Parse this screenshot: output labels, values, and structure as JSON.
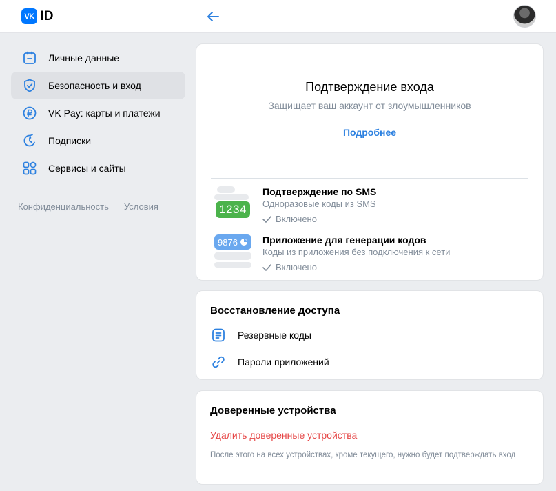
{
  "header": {
    "logo_badge": "VK",
    "logo_text": "ID"
  },
  "sidebar": {
    "items": [
      {
        "label": "Личные данные",
        "icon": "profile-card-icon",
        "active": false
      },
      {
        "label": "Безопасность и вход",
        "icon": "shield-check-icon",
        "active": true
      },
      {
        "label": "VK Pay: карты и платежи",
        "icon": "ruble-circle-icon",
        "active": false
      },
      {
        "label": "Подписки",
        "icon": "subscription-refresh-icon",
        "active": false
      },
      {
        "label": "Сервисы и сайты",
        "icon": "grid-services-icon",
        "active": false
      }
    ],
    "footer_links": [
      "Конфиденциальность",
      "Условия"
    ]
  },
  "login_confirmation": {
    "title": "Подтверждение входа",
    "subtitle": "Защищает ваш аккаунт от злоумышленников",
    "more_link": "Подробнее",
    "methods": [
      {
        "title": "Подтверждение по SMS",
        "subtitle": "Одноразовые коды из SMS",
        "status": "Включено",
        "badge": "1234"
      },
      {
        "title": "Приложение для генерации кодов",
        "subtitle": "Коды из приложения без подключения к сети",
        "status": "Включено",
        "badge": "9876"
      }
    ]
  },
  "recovery": {
    "title": "Восстановление доступа",
    "items": [
      {
        "label": "Резервные коды",
        "icon": "document-list-icon"
      },
      {
        "label": "Пароли приложений",
        "icon": "link-key-icon"
      }
    ]
  },
  "trusted_devices": {
    "title": "Доверенные устройства",
    "action": "Удалить доверенные устройства",
    "note": "После этого на всех устройствах, кроме текущего, нужно будет подтверждать вход"
  },
  "colors": {
    "accent": "#0077ff",
    "link": "#2d81e0",
    "danger": "#e64646",
    "success": "#4bb34b",
    "secondary_text": "#818c99"
  }
}
